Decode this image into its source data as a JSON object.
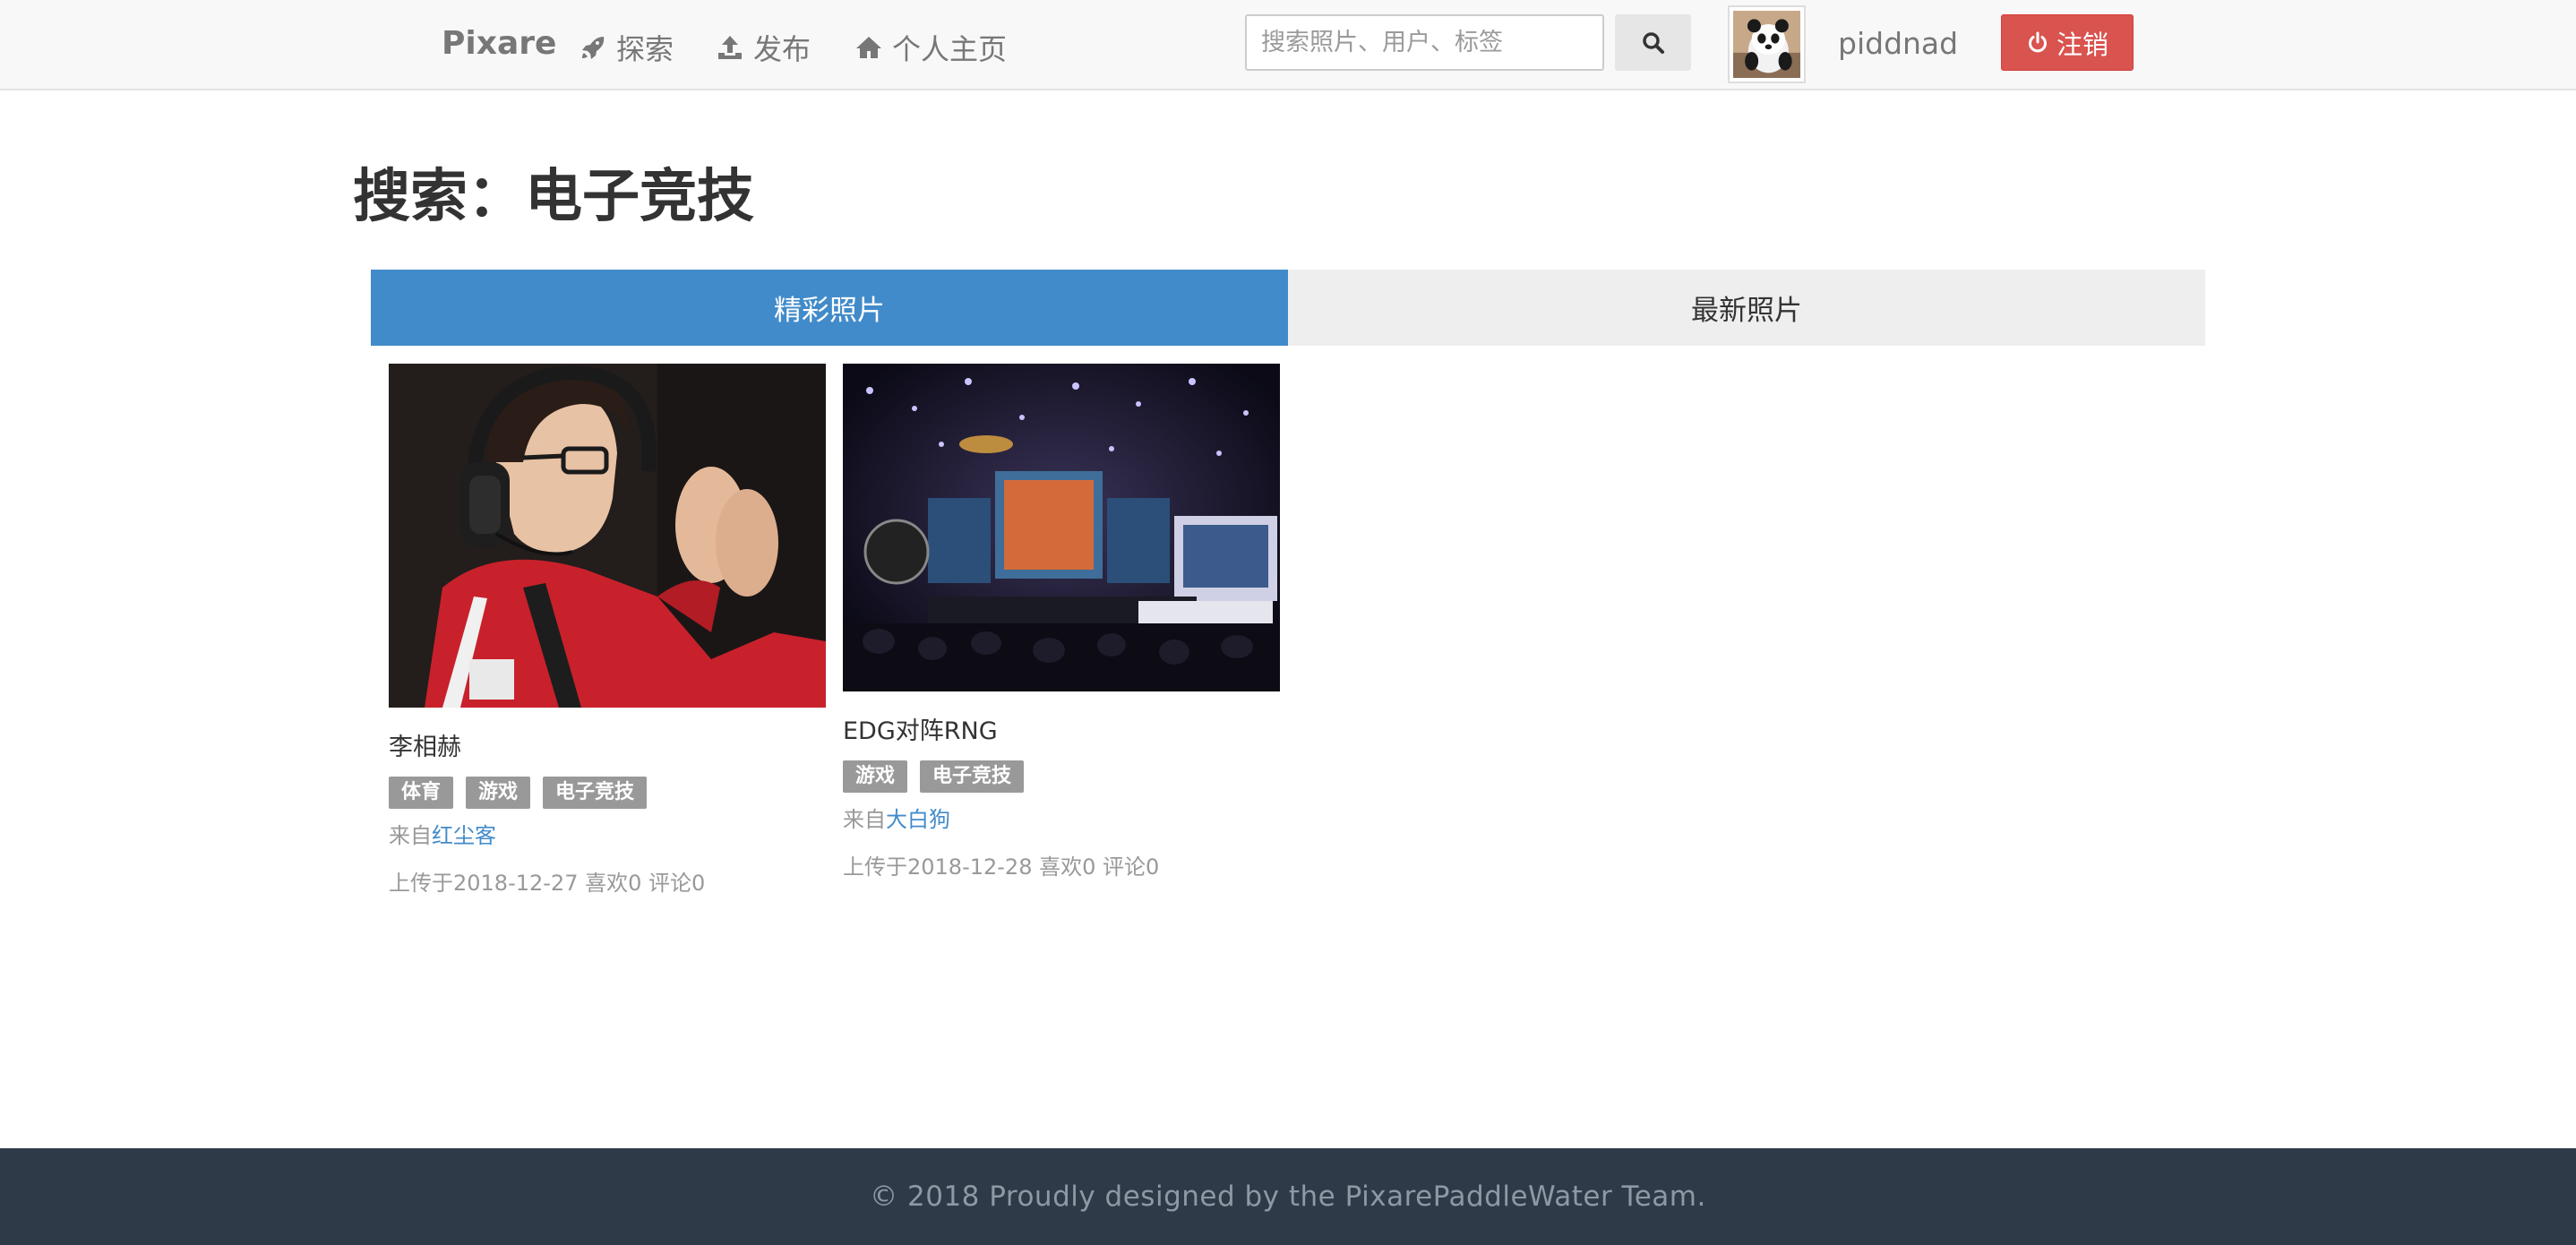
{
  "navbar": {
    "brand": "Pixare",
    "links": [
      {
        "label": "探索",
        "icon": "rocket-icon"
      },
      {
        "label": "发布",
        "icon": "upload-icon"
      },
      {
        "label": "个人主页",
        "icon": "home-icon"
      }
    ],
    "search": {
      "placeholder": "搜索照片、用户、标签",
      "value": "",
      "button_icon": "search-icon"
    },
    "user": {
      "avatar_icon": "panda-avatar",
      "username": "piddnad"
    },
    "logout": {
      "label": "注销",
      "icon": "power-icon",
      "color": "#d9534f"
    }
  },
  "page": {
    "title": "搜索：电子竞技"
  },
  "tabs": [
    {
      "label": "精彩照片",
      "active": true
    },
    {
      "label": "最新照片",
      "active": false
    }
  ],
  "photos": [
    {
      "title": "李相赫",
      "tags": [
        "体育",
        "游戏",
        "电子竞技"
      ],
      "from_prefix": "来自",
      "author": "红尘客",
      "meta": "上传于2018-12-27 喜欢0 评论0"
    },
    {
      "title": "EDG对阵RNG",
      "tags": [
        "游戏",
        "电子竞技"
      ],
      "from_prefix": "来自",
      "author": "大白狗",
      "meta": "上传于2018-12-28 喜欢0 评论0"
    }
  ],
  "footer": {
    "text": "© 2018 Proudly designed by the PixarePaddleWater Team."
  },
  "colors": {
    "accent": "#428bca",
    "danger": "#d9534f",
    "tag": "#999999",
    "footer_bg": "#2e3a48"
  }
}
